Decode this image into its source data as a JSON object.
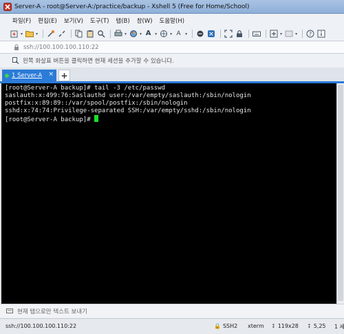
{
  "window": {
    "title": "Server-A - root@Server-A:/practice/backup - Xshell 5 (Free for Home/School)"
  },
  "menubar": {
    "items": [
      "파일(F)",
      "편집(E)",
      "보기(V)",
      "도구(T)",
      "탭(B)",
      "창(W)",
      "도움말(H)"
    ]
  },
  "toolbar": {
    "icons": [
      "new-session-icon",
      "open-folder-icon",
      "connect-icon",
      "disconnect-icon",
      "copy-icon",
      "paste-icon",
      "find-icon",
      "print-icon",
      "color-scheme-icon",
      "font-icon",
      "globe-icon",
      "font-size-icon",
      "xftp-icon",
      "xmanager-icon",
      "fullscreen-icon",
      "lock-icon",
      "keyboard-icon",
      "add-icon",
      "layout-icon",
      "help-icon",
      "info-icon"
    ]
  },
  "address": {
    "text": "ssh://100.100.100.110:22"
  },
  "hint": {
    "text": "왼쪽 화살표 버튼을 클릭하면 현재 세션을 추가할 수 있습니다."
  },
  "tabs": {
    "session_label": "1 Server-A",
    "close_glyph": "×",
    "new_tab_glyph": "+"
  },
  "terminal": {
    "lines": [
      "[root@Server-A backup]# tail -3 /etc/passwd",
      "saslauth:x:499:76:Saslauthd user:/var/empty/saslauth:/sbin/nologin",
      "postfix:x:89:89::/var/spool/postfix:/sbin/nologin",
      "sshd:x:74:74:Privilege-separated SSH:/var/empty/sshd:/sbin/nologin"
    ],
    "prompt": "[root@Server-A backup]# ",
    "cursor_color": "#19e02a"
  },
  "compose": {
    "text": "현재 탭으로만 텍스트 보내기"
  },
  "status": {
    "address": "ssh://100.100.100.110:22",
    "protocol": "SSH2",
    "terminal_type": "xterm",
    "size": "119x28",
    "cursor_pos": "5,25",
    "sessions": "1 세"
  },
  "colors": {
    "titlebar": "#9fbbe0",
    "tab_active": "#2b7bd8",
    "terminal_bg": "#000000",
    "terminal_fg": "#e6e6e6"
  }
}
